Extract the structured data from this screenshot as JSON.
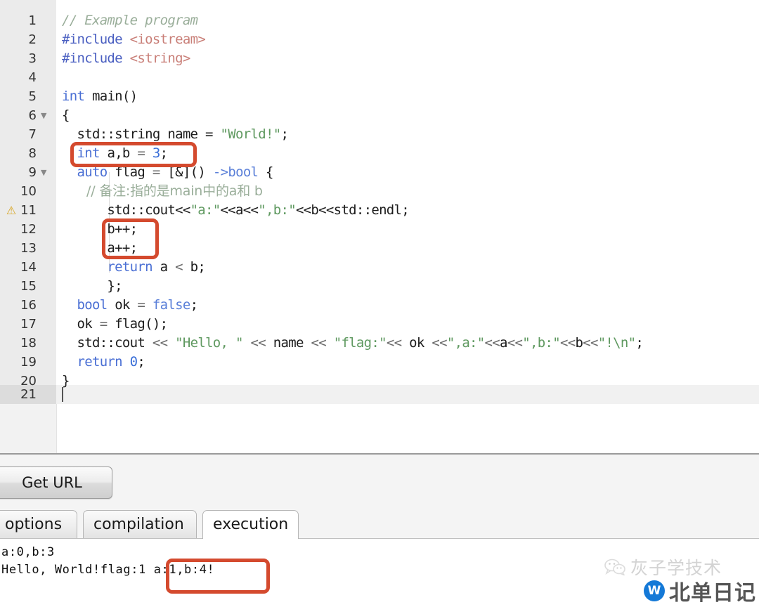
{
  "editor": {
    "active_line": 21,
    "total_lines": 21,
    "warning_line": 11,
    "fold_lines": [
      6,
      9
    ],
    "lines": [
      {
        "no": 1,
        "text": "// Example program"
      },
      {
        "no": 2,
        "text": "#include <iostream>"
      },
      {
        "no": 3,
        "text": "#include <string>"
      },
      {
        "no": 4,
        "text": ""
      },
      {
        "no": 5,
        "text": "int main()"
      },
      {
        "no": 6,
        "text": "{"
      },
      {
        "no": 7,
        "text": "  std::string name = \"World!\";"
      },
      {
        "no": 8,
        "text": "  int a,b = 3;"
      },
      {
        "no": 9,
        "text": "  auto flag = [&]() ->bool {"
      },
      {
        "no": 10,
        "text": "      // 备注:指的是main中的a和 b"
      },
      {
        "no": 11,
        "text": "      std::cout<<\"a:\"<<a<<\",b:\"<<b<<std::endl;"
      },
      {
        "no": 12,
        "text": "      b++;"
      },
      {
        "no": 13,
        "text": "      a++;"
      },
      {
        "no": 14,
        "text": "      return a < b;"
      },
      {
        "no": 15,
        "text": "      };"
      },
      {
        "no": 16,
        "text": "  bool ok = false;"
      },
      {
        "no": 17,
        "text": "  ok = flag();"
      },
      {
        "no": 18,
        "text": "  std::cout << \"Hello, \" << name << \"flag:\"<< ok <<\",a:\"<<a<<\",b:\"<<b<<\"!\\n\";"
      },
      {
        "no": 19,
        "text": "  return 0;"
      },
      {
        "no": 20,
        "text": "}"
      },
      {
        "no": 21,
        "text": ""
      }
    ],
    "warning_icon": "warning-triangle-icon",
    "fold_icon": "chevron-down-icon",
    "annotations": [
      {
        "id": "annot-line8",
        "label": "int a,b = 3;"
      },
      {
        "id": "annot-lines12-13",
        "label": "b++; a++;"
      },
      {
        "id": "annot-output",
        "label": "a:1,b:4!"
      }
    ]
  },
  "colors": {
    "annotation_red": "#d44a2e",
    "comment": "#9aae9a",
    "preprocessor": "#4a5fc1",
    "include_header": "#c97f78",
    "keyword": "#4a6fd4",
    "string": "#5f9960",
    "number": "#3a6fd8",
    "warning": "#d8a41c",
    "badge_blue": "#1479d7"
  },
  "toolbar": {
    "get_url_label": "Get URL"
  },
  "tabs": [
    {
      "label": "options",
      "active": false
    },
    {
      "label": "compilation",
      "active": false
    },
    {
      "label": "execution",
      "active": true
    }
  ],
  "output": {
    "lines": [
      "a:0,b:3",
      "Hello, World!flag:1 a:1,b:4!"
    ],
    "line2_prefix": "Hello, World!flag:1",
    "line2_highlight": "a:1,b:4!"
  },
  "watermark": {
    "line1": "灰子学技术",
    "line2": "北单日记",
    "wechat_icon": "wechat-chat-icon",
    "badge_icon": "w-badge-icon",
    "badge_glyph": "W"
  }
}
